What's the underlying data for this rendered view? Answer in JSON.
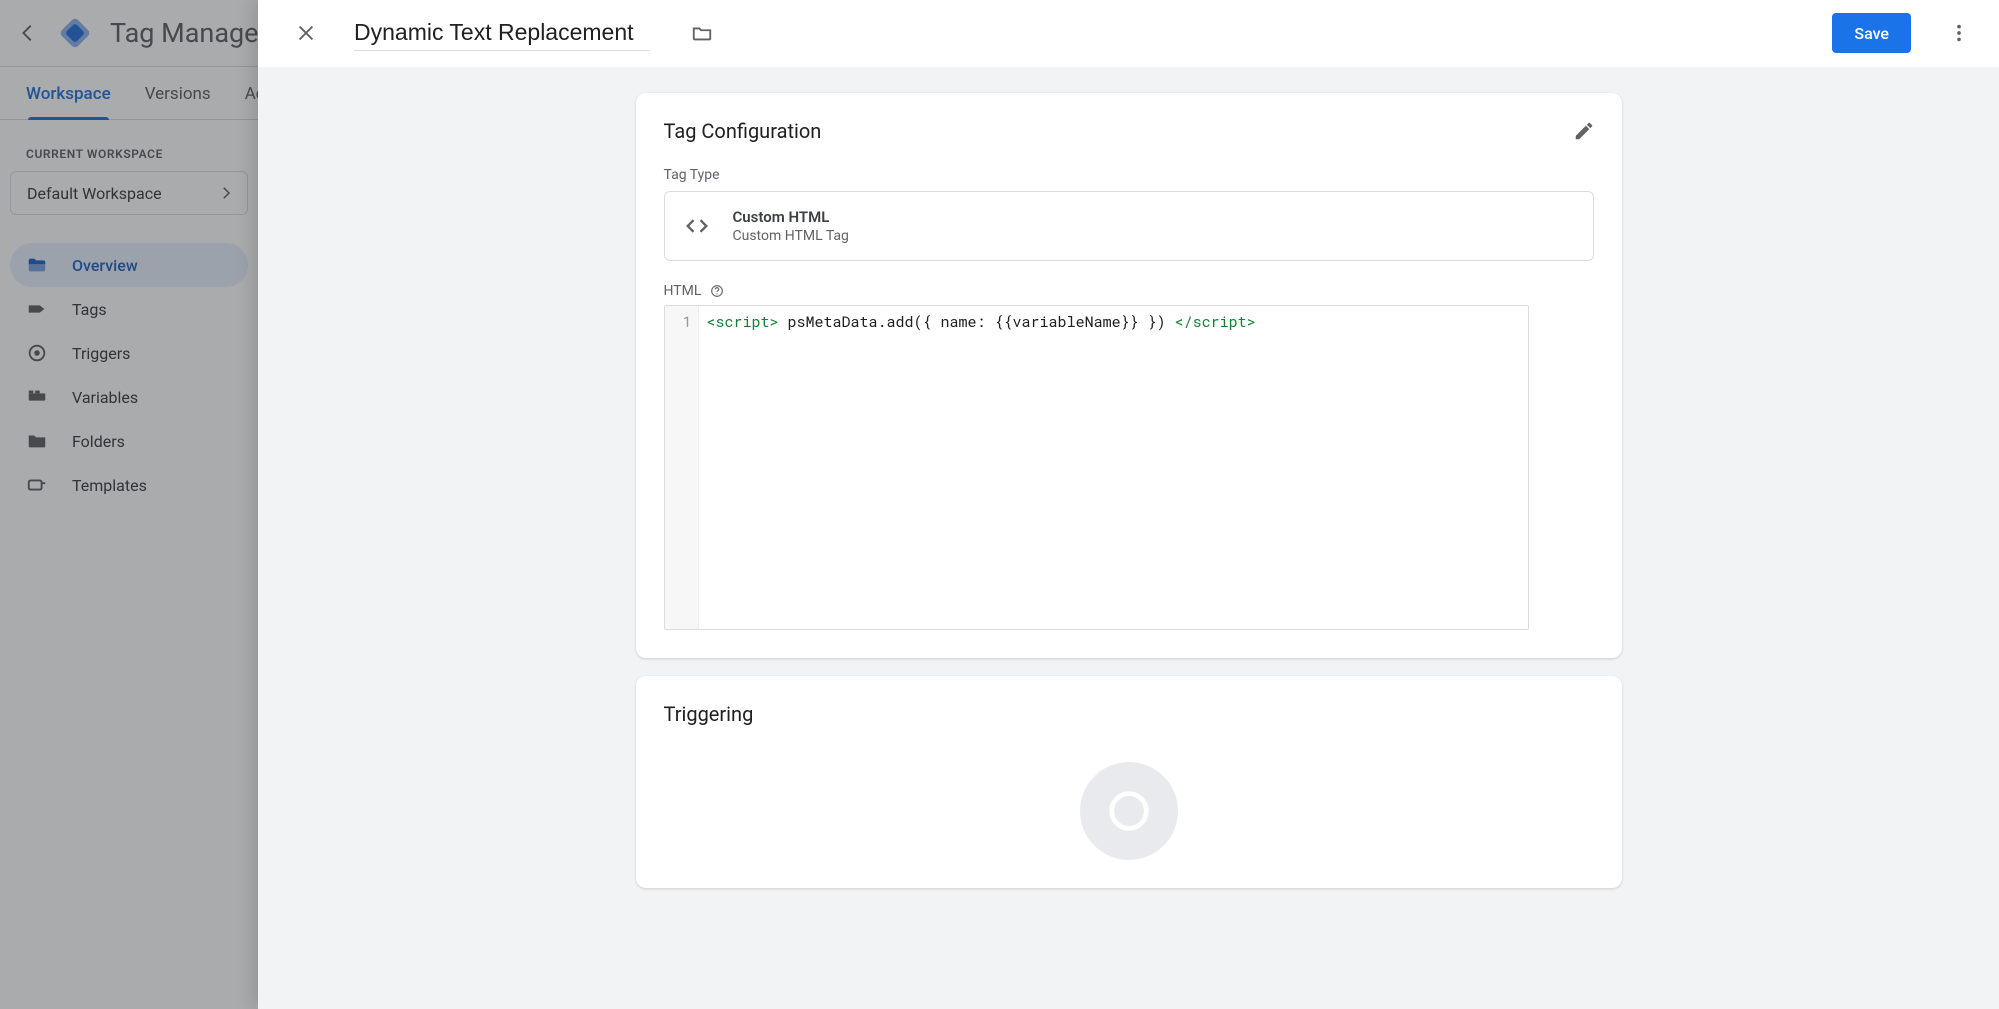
{
  "app": {
    "name": "Tag Manager"
  },
  "tabs": {
    "workspace": "Workspace",
    "versions": "Versions",
    "admin": "Ad"
  },
  "workspace": {
    "section_label": "CURRENT WORKSPACE",
    "current": "Default Workspace"
  },
  "nav": {
    "overview": "Overview",
    "tags": "Tags",
    "triggers": "Triggers",
    "variables": "Variables",
    "folders": "Folders",
    "templates": "Templates"
  },
  "panel": {
    "title": "Dynamic Text Replacement",
    "save": "Save"
  },
  "config": {
    "card_title": "Tag Configuration",
    "tag_type_label": "Tag Type",
    "tag_type_title": "Custom HTML",
    "tag_type_sub": "Custom HTML Tag",
    "html_label": "HTML",
    "code_line_no": "1",
    "code": {
      "open": "<script>",
      "body": " psMetaData.add({ name: {{variableName}} }) ",
      "close": "</script>"
    }
  },
  "triggering": {
    "card_title": "Triggering"
  }
}
